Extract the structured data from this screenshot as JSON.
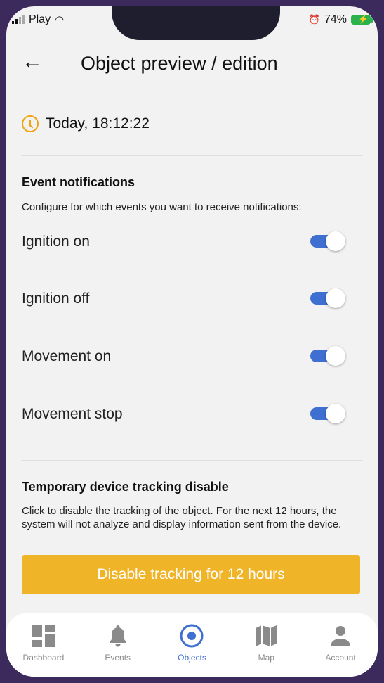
{
  "status": {
    "carrier": "Play",
    "battery": "74%"
  },
  "header": {
    "title": "Object preview / edition"
  },
  "time": {
    "text": "Today, 18:12:22"
  },
  "notifications": {
    "title": "Event notifications",
    "desc": "Configure for which events you want to receive notifications:",
    "items": [
      {
        "label": "Ignition on",
        "on": true
      },
      {
        "label": "Ignition off",
        "on": true
      },
      {
        "label": "Movement on",
        "on": true
      },
      {
        "label": "Movement stop",
        "on": true
      }
    ]
  },
  "tracking": {
    "title": "Temporary device tracking disable",
    "desc": "Click to disable the tracking of the object. For the next 12 hours, the system will not analyze and display information sent from the device.",
    "button": "Disable tracking for 12 hours"
  },
  "tabs": [
    {
      "label": "Dashboard",
      "icon": "dashboard-icon"
    },
    {
      "label": "Events",
      "icon": "bell-icon"
    },
    {
      "label": "Objects",
      "icon": "target-icon",
      "active": true
    },
    {
      "label": "Map",
      "icon": "map-icon"
    },
    {
      "label": "Account",
      "icon": "person-icon"
    }
  ],
  "colors": {
    "accent": "#3f6fd0",
    "cta": "#f0b429",
    "clock": "#f0a30a"
  }
}
